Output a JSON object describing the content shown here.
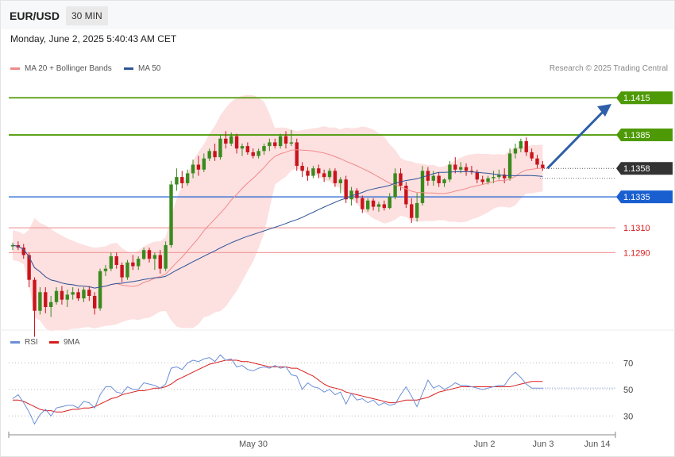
{
  "header": {
    "symbol": "EUR/USD",
    "timeframe": "30 MIN"
  },
  "datetime": "Monday, June 2, 2025 5:40:43 AM CET",
  "legend": {
    "bollinger": {
      "label": "MA 20 + Bollinger Bands",
      "color": "#f08a8a"
    },
    "ma50": {
      "label": "MA 50",
      "color": "#2f5597"
    },
    "rsi": {
      "label": "RSI",
      "color": "#6b8fd6"
    },
    "rsi_ma": {
      "label": "9MA",
      "color": "#d91c1c"
    }
  },
  "credit": "Research © 2025 Trading Central",
  "chart_data": {
    "type": "candlestick",
    "ylim": [
      1.123,
      1.1435
    ],
    "levels": [
      {
        "value": 1.1415,
        "label": "1.1415",
        "kind": "resistance",
        "color": "#4e9a06"
      },
      {
        "value": 1.1385,
        "label": "1.1385",
        "kind": "resistance",
        "color": "#4e9a06"
      },
      {
        "value": 1.1358,
        "label": "1.1358",
        "kind": "last",
        "color": "#333333"
      },
      {
        "value": 1.1335,
        "label": "1.1335",
        "kind": "pivot",
        "color": "#1a5fd0"
      },
      {
        "value": 1.131,
        "label": "1.1310",
        "kind": "support",
        "color": "#d91c1c"
      },
      {
        "value": 1.129,
        "label": "1.1290",
        "kind": "support",
        "color": "#d91c1c"
      }
    ],
    "arrow": {
      "from": 1.1358,
      "to": 1.141
    },
    "x_ticks": [
      "May 30",
      "Jun 2",
      "Jun 3",
      "Jun 14"
    ],
    "candles": [
      [
        1.1295,
        1.1298,
        1.1292,
        1.1296
      ],
      [
        1.1296,
        1.1299,
        1.1292,
        1.1294
      ],
      [
        1.1294,
        1.1297,
        1.1285,
        1.1288
      ],
      [
        1.1288,
        1.129,
        1.1262,
        1.1268
      ],
      [
        1.1268,
        1.127,
        1.1222,
        1.1243
      ],
      [
        1.1243,
        1.1262,
        1.124,
        1.1258
      ],
      [
        1.1258,
        1.1262,
        1.1241,
        1.1246
      ],
      [
        1.1246,
        1.1255,
        1.1238,
        1.125
      ],
      [
        1.125,
        1.1262,
        1.1248,
        1.1259
      ],
      [
        1.1259,
        1.1263,
        1.1248,
        1.1252
      ],
      [
        1.1252,
        1.126,
        1.1246,
        1.1256
      ],
      [
        1.1256,
        1.1262,
        1.1252,
        1.1258
      ],
      [
        1.1258,
        1.1261,
        1.1251,
        1.1253
      ],
      [
        1.1253,
        1.1262,
        1.125,
        1.126
      ],
      [
        1.126,
        1.1263,
        1.1251,
        1.1255
      ],
      [
        1.1255,
        1.1258,
        1.124,
        1.1245
      ],
      [
        1.1245,
        1.1277,
        1.1243,
        1.1275
      ],
      [
        1.1275,
        1.128,
        1.1271,
        1.1277
      ],
      [
        1.1277,
        1.129,
        1.1275,
        1.1287
      ],
      [
        1.1287,
        1.129,
        1.1277,
        1.128
      ],
      [
        1.128,
        1.1282,
        1.1266,
        1.127
      ],
      [
        1.127,
        1.1284,
        1.1268,
        1.1282
      ],
      [
        1.1282,
        1.1288,
        1.1276,
        1.1279
      ],
      [
        1.1279,
        1.1287,
        1.1276,
        1.1285
      ],
      [
        1.1285,
        1.1294,
        1.1284,
        1.1292
      ],
      [
        1.1292,
        1.1294,
        1.1282,
        1.1285
      ],
      [
        1.1285,
        1.129,
        1.1276,
        1.1288
      ],
      [
        1.1288,
        1.1292,
        1.1273,
        1.1277
      ],
      [
        1.1277,
        1.1299,
        1.1275,
        1.1296
      ],
      [
        1.1296,
        1.1348,
        1.1294,
        1.1345
      ],
      [
        1.1345,
        1.1358,
        1.134,
        1.1351
      ],
      [
        1.1351,
        1.1356,
        1.1342,
        1.1346
      ],
      [
        1.1346,
        1.1357,
        1.1344,
        1.1354
      ],
      [
        1.1354,
        1.1365,
        1.135,
        1.1361
      ],
      [
        1.1361,
        1.1368,
        1.1352,
        1.1357
      ],
      [
        1.1357,
        1.137,
        1.1355,
        1.1366
      ],
      [
        1.1366,
        1.1374,
        1.1364,
        1.1372
      ],
      [
        1.1372,
        1.1378,
        1.1364,
        1.1367
      ],
      [
        1.1367,
        1.1385,
        1.1365,
        1.1382
      ],
      [
        1.1382,
        1.1388,
        1.1374,
        1.1378
      ],
      [
        1.1378,
        1.1387,
        1.1376,
        1.1384
      ],
      [
        1.1384,
        1.1386,
        1.137,
        1.1374
      ],
      [
        1.1374,
        1.1378,
        1.1368,
        1.1376
      ],
      [
        1.1376,
        1.1379,
        1.1369,
        1.1371
      ],
      [
        1.1371,
        1.1374,
        1.1366,
        1.1368
      ],
      [
        1.1368,
        1.1374,
        1.1366,
        1.1372
      ],
      [
        1.1372,
        1.1378,
        1.1369,
        1.1376
      ],
      [
        1.1376,
        1.1382,
        1.1372,
        1.1379
      ],
      [
        1.1379,
        1.1382,
        1.1374,
        1.1376
      ],
      [
        1.1376,
        1.1386,
        1.1374,
        1.1384
      ],
      [
        1.1384,
        1.1388,
        1.1374,
        1.1378
      ],
      [
        1.1378,
        1.1389,
        1.1376,
        1.1379
      ],
      [
        1.1379,
        1.1382,
        1.1356,
        1.136
      ],
      [
        1.136,
        1.1363,
        1.1351,
        1.1356
      ],
      [
        1.1356,
        1.1359,
        1.1348,
        1.1352
      ],
      [
        1.1352,
        1.136,
        1.135,
        1.1358
      ],
      [
        1.1358,
        1.1361,
        1.135,
        1.1354
      ],
      [
        1.1354,
        1.1357,
        1.1347,
        1.1351
      ],
      [
        1.1351,
        1.1358,
        1.1349,
        1.1356
      ],
      [
        1.1356,
        1.1358,
        1.1343,
        1.1346
      ],
      [
        1.1346,
        1.1351,
        1.1338,
        1.1349
      ],
      [
        1.1349,
        1.1352,
        1.133,
        1.1333
      ],
      [
        1.1333,
        1.1343,
        1.1328,
        1.134
      ],
      [
        1.134,
        1.1342,
        1.133,
        1.1334
      ],
      [
        1.1334,
        1.1336,
        1.1322,
        1.1325
      ],
      [
        1.1325,
        1.1334,
        1.1323,
        1.1332
      ],
      [
        1.1332,
        1.1334,
        1.1324,
        1.1327
      ],
      [
        1.1327,
        1.1331,
        1.1323,
        1.1329
      ],
      [
        1.1329,
        1.1332,
        1.1324,
        1.1326
      ],
      [
        1.1326,
        1.1338,
        1.1325,
        1.1335
      ],
      [
        1.1335,
        1.1358,
        1.1333,
        1.1354
      ],
      [
        1.1354,
        1.1358,
        1.134,
        1.1344
      ],
      [
        1.1344,
        1.1347,
        1.1326,
        1.1329
      ],
      [
        1.1329,
        1.1334,
        1.1314,
        1.1318
      ],
      [
        1.1318,
        1.1338,
        1.1315,
        1.133
      ],
      [
        1.133,
        1.136,
        1.1328,
        1.1356
      ],
      [
        1.1356,
        1.1359,
        1.1344,
        1.1348
      ],
      [
        1.1348,
        1.1356,
        1.1344,
        1.1352
      ],
      [
        1.1352,
        1.1355,
        1.1343,
        1.1346
      ],
      [
        1.1346,
        1.135,
        1.1343,
        1.1349
      ],
      [
        1.1349,
        1.1364,
        1.1347,
        1.1361
      ],
      [
        1.1361,
        1.1367,
        1.1354,
        1.1357
      ],
      [
        1.1357,
        1.1363,
        1.1354,
        1.1359
      ],
      [
        1.1359,
        1.1362,
        1.1352,
        1.1356
      ],
      [
        1.1356,
        1.136,
        1.1353,
        1.1355
      ],
      [
        1.1355,
        1.1357,
        1.1346,
        1.1349
      ],
      [
        1.1349,
        1.1352,
        1.1345,
        1.1347
      ],
      [
        1.1347,
        1.1352,
        1.1345,
        1.135
      ],
      [
        1.135,
        1.1356,
        1.1346,
        1.1351
      ],
      [
        1.1351,
        1.1357,
        1.1349,
        1.1353
      ],
      [
        1.1353,
        1.1358,
        1.1346,
        1.135
      ],
      [
        1.135,
        1.1374,
        1.1348,
        1.137
      ],
      [
        1.137,
        1.1378,
        1.1366,
        1.1374
      ],
      [
        1.1374,
        1.1382,
        1.1371,
        1.138
      ],
      [
        1.138,
        1.1383,
        1.1368,
        1.1371
      ],
      [
        1.1371,
        1.1374,
        1.1364,
        1.1366
      ],
      [
        1.1366,
        1.1369,
        1.1358,
        1.1361
      ],
      [
        1.1361,
        1.1364,
        1.1356,
        1.1358
      ]
    ],
    "rsi": {
      "ylim": [
        20,
        78
      ],
      "ticks": [
        70,
        50,
        30
      ],
      "values": [
        43,
        46,
        40,
        33,
        24,
        31,
        35,
        30,
        36,
        37,
        38,
        38,
        36,
        41,
        40,
        36,
        46,
        52,
        52,
        48,
        47,
        52,
        50,
        50,
        55,
        54,
        53,
        51,
        54,
        66,
        67,
        65,
        70,
        72,
        71,
        73,
        74,
        71,
        76,
        72,
        73,
        67,
        68,
        65,
        64,
        66,
        67,
        66,
        68,
        66,
        67,
        61,
        60,
        50,
        55,
        52,
        51,
        48,
        50,
        46,
        48,
        39,
        47,
        42,
        43,
        40,
        42,
        38,
        40,
        38,
        39,
        46,
        52,
        45,
        37,
        47,
        57,
        51,
        53,
        50,
        52,
        55,
        53,
        53,
        52,
        51,
        50,
        51,
        52,
        53,
        53,
        59,
        63,
        59,
        54,
        51,
        51,
        51
      ],
      "ma": [
        42,
        42,
        41,
        39,
        37,
        35,
        34,
        34,
        33,
        33,
        34,
        35,
        35,
        36,
        36,
        37,
        39,
        41,
        43,
        44,
        46,
        47,
        48,
        49,
        49,
        50,
        51,
        51,
        52,
        54,
        57,
        59,
        61,
        63,
        65,
        67,
        69,
        70,
        71,
        72,
        72,
        72,
        71,
        71,
        70,
        69,
        68,
        67,
        67,
        67,
        67,
        66,
        66,
        64,
        62,
        60,
        57,
        54,
        52,
        51,
        50,
        48,
        47,
        46,
        45,
        44,
        43,
        42,
        41,
        40,
        40,
        41,
        42,
        42,
        42,
        43,
        44,
        46,
        48,
        49,
        50,
        51,
        52,
        52,
        52,
        52,
        52,
        52,
        52,
        52,
        52,
        52,
        53,
        54,
        55,
        56,
        56,
        56
      ]
    }
  }
}
